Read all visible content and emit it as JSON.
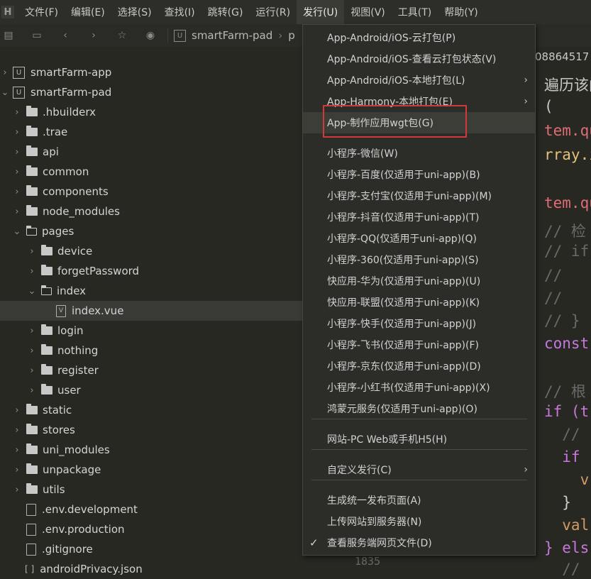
{
  "menubar": {
    "items": [
      "文件(F)",
      "编辑(E)",
      "选择(S)",
      "查找(I)",
      "跳转(G)",
      "运行(R)",
      "发行(U)",
      "视图(V)",
      "工具(T)",
      "帮助(Y)"
    ]
  },
  "toolbar": {
    "breadcrumb_project": "smartFarm-pad",
    "breadcrumb_next": "p"
  },
  "tree": {
    "items": [
      {
        "label": "smartFarm-app"
      },
      {
        "label": "smartFarm-pad"
      },
      {
        "label": ".hbuilderx"
      },
      {
        "label": ".trae"
      },
      {
        "label": "api"
      },
      {
        "label": "common"
      },
      {
        "label": "components"
      },
      {
        "label": "node_modules"
      },
      {
        "label": "pages"
      },
      {
        "label": "device"
      },
      {
        "label": "forgetPassword"
      },
      {
        "label": "index"
      },
      {
        "label": "index.vue"
      },
      {
        "label": "login"
      },
      {
        "label": "nothing"
      },
      {
        "label": "register"
      },
      {
        "label": "user"
      },
      {
        "label": "static"
      },
      {
        "label": "stores"
      },
      {
        "label": "uni_modules"
      },
      {
        "label": "unpackage"
      },
      {
        "label": "utils"
      },
      {
        "label": ".env.development"
      },
      {
        "label": ".env.production"
      },
      {
        "label": ".gitignore"
      },
      {
        "label": "androidPrivacy.json"
      }
    ]
  },
  "editor": {
    "tab_text": "08864517",
    "lines": [
      "遍历该阁",
      "(",
      "tem.qu",
      "rray.i",
      "",
      "tem.qu",
      "// 检",
      "// if",
      "//",
      "//",
      "// }",
      "const",
      "",
      "// 根",
      "if (t",
      "  //",
      "  if",
      "    v",
      "  }",
      "  val",
      "} els",
      "  //"
    ],
    "gutter_number": "1835"
  },
  "dropdown": {
    "items": [
      "App-Android/iOS-云打包(P)",
      "App-Android/iOS-查看云打包状态(V)",
      "App-Android/iOS-本地打包(L)",
      "App-Harmony-本地打包(E)",
      "App-制作应用wgt包(G)",
      "小程序-微信(W)",
      "小程序-百度(仅适用于uni-app)(B)",
      "小程序-支付宝(仅适用于uni-app)(M)",
      "小程序-抖音(仅适用于uni-app)(T)",
      "小程序-QQ(仅适用于uni-app)(Q)",
      "小程序-360(仅适用于uni-app)(S)",
      "快应用-华为(仅适用于uni-app)(U)",
      "快应用-联盟(仅适用于uni-app)(K)",
      "小程序-快手(仅适用于uni-app)(J)",
      "小程序-飞书(仅适用于uni-app)(F)",
      "小程序-京东(仅适用于uni-app)(D)",
      "小程序-小红书(仅适用于uni-app)(X)",
      "鸿蒙元服务(仅适用于uni-app)(O)",
      "网站-PC Web或手机H5(H)",
      "自定义发行(C)",
      "生成统一发布页面(A)",
      "上传网站到服务器(N)",
      "查看服务端网页文件(D)"
    ]
  },
  "colors": {
    "accent_box": "#d23a3a",
    "keyword": "#c678dd",
    "property": "#e06c75",
    "method": "#61afef",
    "comment": "#6a6a6a",
    "identifier": "#d19a66"
  }
}
